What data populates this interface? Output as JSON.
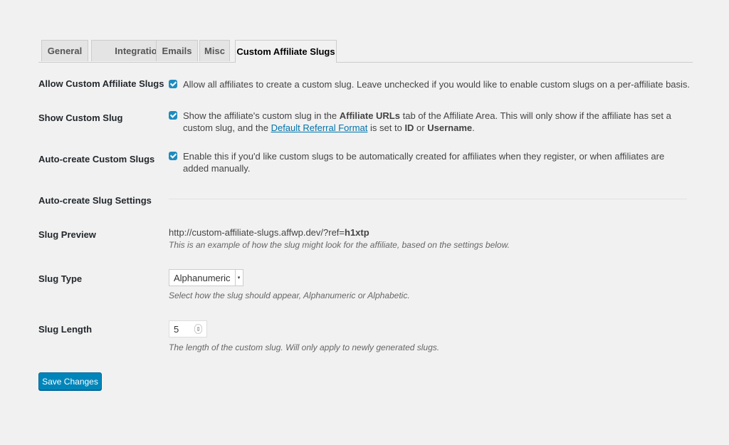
{
  "tabs": [
    "General",
    "Integrations",
    "Emails",
    "Misc",
    "Custom Affiliate Slugs"
  ],
  "active_tab": "Custom Affiliate Slugs",
  "rows": {
    "allow": {
      "label": "Allow Custom Affiliate Slugs",
      "checked": true,
      "text": "Allow all affiliates to create a custom slug. Leave unchecked if you would like to enable custom slugs on a per-affiliate basis."
    },
    "show": {
      "label": "Show Custom Slug",
      "checked": true,
      "text_1": "Show the affiliate's custom slug in the ",
      "bold_1": "Affiliate URLs",
      "text_2": " tab of the Affiliate Area. This will only show if the affiliate has set a custom slug, and the ",
      "link": "Default Referral Format",
      "text_3": " is set to ",
      "bold_2": "ID",
      "text_4": " or ",
      "bold_3": "Username",
      "text_5": "."
    },
    "auto": {
      "label": "Auto-create Custom Slugs",
      "checked": true,
      "text": "Enable this if you'd like custom slugs to be automatically created for affiliates when they register, or when affiliates are added manually."
    },
    "auto_settings": {
      "label": "Auto-create Slug Settings"
    },
    "preview": {
      "label": "Slug Preview",
      "url_prefix": "http://custom-affiliate-slugs.affwp.dev/?ref=",
      "slug": "h1xtp",
      "description": "This is an example of how the slug might look for the affiliate, based on the settings below."
    },
    "type": {
      "label": "Slug Type",
      "selected": "Alphanumeric",
      "description": "Select how the slug should appear, Alphanumeric or Alphabetic."
    },
    "length": {
      "label": "Slug Length",
      "value": "5",
      "description": "The length of the custom slug. Will only apply to newly generated slugs."
    }
  },
  "save_label": "Save Changes",
  "colors": {
    "accent": "#0085ba",
    "checkbox": "#1e8cbe",
    "link": "#0073aa",
    "background": "#f1f1f1"
  },
  "icons": {
    "checkbox": "checkmark-icon",
    "select": "select-arrow-icon",
    "spinner": "number-spinner-icon"
  }
}
